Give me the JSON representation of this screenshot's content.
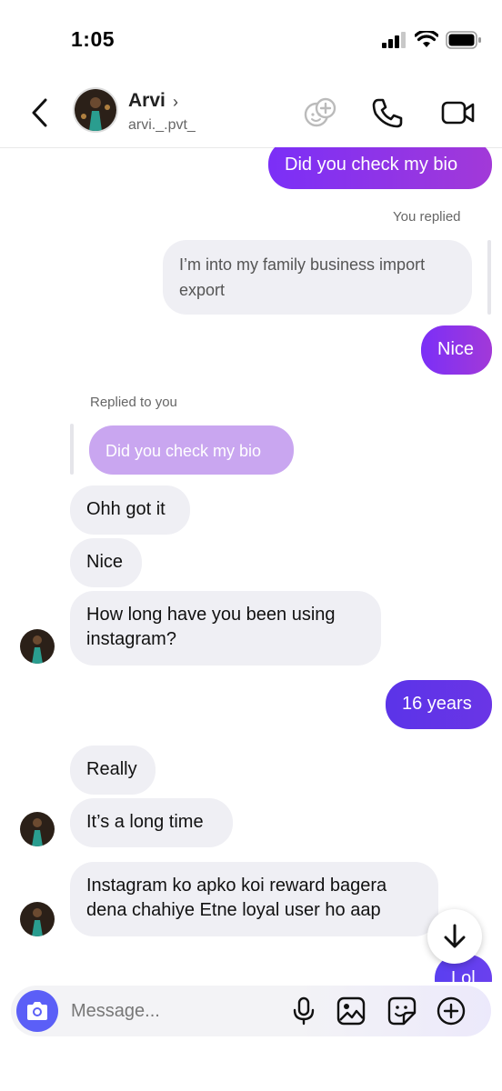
{
  "status_bar": {
    "time": "1:05"
  },
  "header": {
    "name": "Arvi",
    "name_chevron": "›",
    "handle": "arvi._.pvt_"
  },
  "messages": {
    "m1": "Did you check my bio",
    "replied_label": "You replied",
    "m2": "I’m into my family business import export",
    "m3": "Nice",
    "replied_to_label": "Replied to you",
    "m4_quote": "Did you check my bio",
    "m5": "Ohh got it",
    "m6": "Nice",
    "m7": "How long have you been using instagram?",
    "m8": "16 years",
    "m9": "Really",
    "m10": "It’s a long time",
    "m11": "Instagram ko apko koi reward bagera dena chahiye Etne loyal user ho aap",
    "m12": "Lol"
  },
  "composer": {
    "placeholder": "Message..."
  },
  "colors": {
    "accent": "#7b2ff7",
    "incoming_bubble": "#efeff4",
    "camera_button": "#5b5ff7"
  }
}
